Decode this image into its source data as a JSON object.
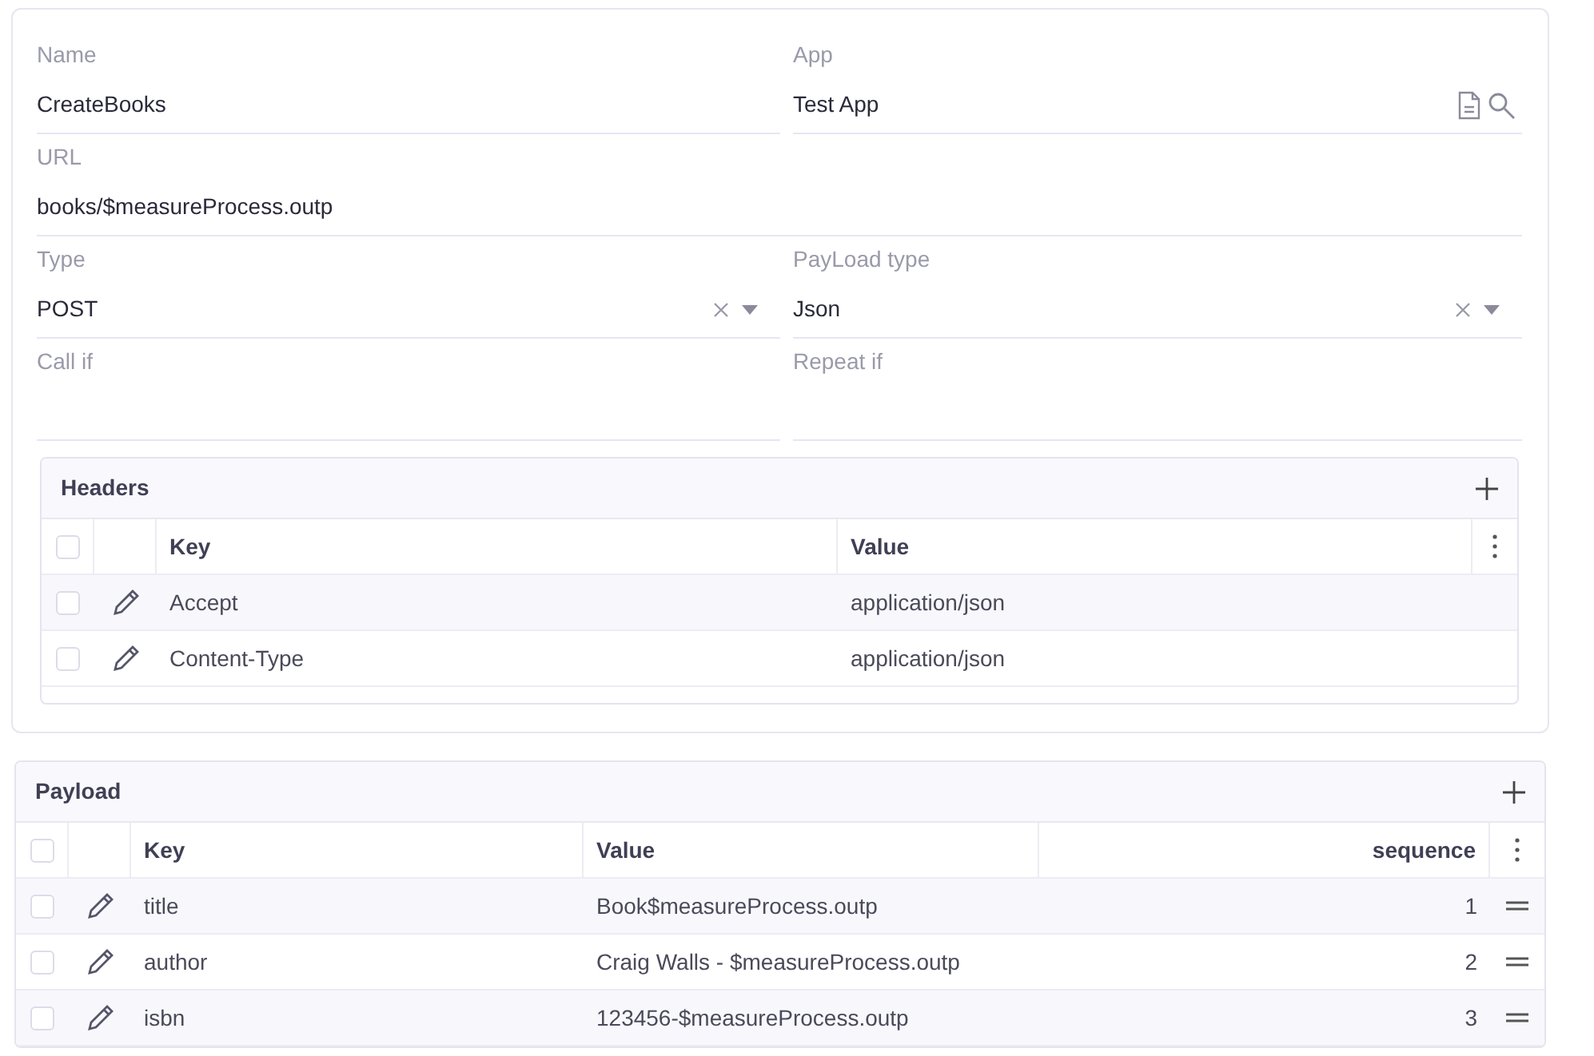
{
  "form": {
    "rows": [
      [
        {
          "label": "Name",
          "value": "CreateBooks",
          "kind": "text"
        },
        {
          "label": "App",
          "value": "Test App",
          "kind": "lookup"
        }
      ],
      [
        {
          "label": "URL",
          "value": "books/$measureProcess.outp",
          "kind": "text"
        }
      ],
      [
        {
          "label": "Type",
          "value": "POST",
          "kind": "select"
        },
        {
          "label": "PayLoad type",
          "value": "Json",
          "kind": "select"
        }
      ],
      [
        {
          "label": "Call if",
          "kind": "text"
        },
        {
          "label": "Repeat if",
          "kind": "text"
        }
      ]
    ]
  },
  "headers": {
    "title": "Headers",
    "all_checked": false,
    "columns": [
      "Key",
      "Value"
    ],
    "rows": [
      {
        "key": "Accept",
        "value": "application/json",
        "checked": false
      },
      {
        "key": "Content-Type",
        "value": "application/json",
        "checked": false
      }
    ]
  },
  "payload": {
    "title": "Payload",
    "all_checked": false,
    "columns": [
      "Key",
      "Value",
      "sequence"
    ],
    "rows": [
      {
        "key": "title",
        "value": "Book$measureProcess.outp",
        "sequence": "1",
        "checked": false
      },
      {
        "key": "author",
        "value": "Craig Walls - $measureProcess.outp",
        "sequence": "2",
        "checked": false
      },
      {
        "key": "isbn",
        "value": "123456-$measureProcess.outp",
        "sequence": "3",
        "checked": false
      }
    ]
  }
}
